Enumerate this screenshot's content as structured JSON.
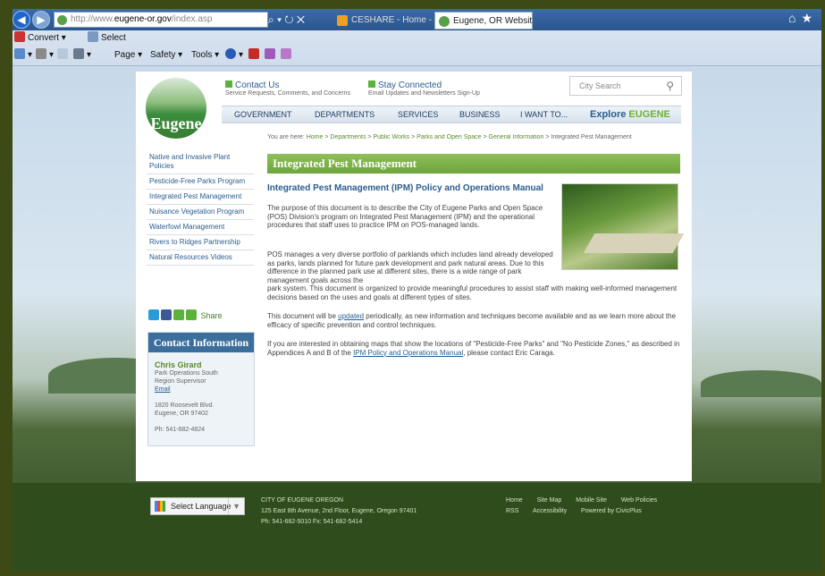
{
  "browser": {
    "url_prefix": "http://www.",
    "url_domain": "eugene-or.gov",
    "url_suffix": "/index.asp",
    "addr_controls": "⌕ ▾ ↻ ✕",
    "tabs": [
      {
        "label": "CESHARE - Home - Cit..."
      },
      {
        "label": "Eugene, OR Website... ×"
      }
    ],
    "toolbar1": {
      "convert": "Convert ▾",
      "select": "Select"
    },
    "toolbar2": {
      "page": "Page ▾",
      "safety": "Safety ▾",
      "tools": "Tools ▾"
    }
  },
  "site": {
    "logo": "Eugene",
    "contact_us": {
      "title": "Contact Us",
      "sub": "Service Requests, Comments, and Concerns"
    },
    "stay_connected": {
      "title": "Stay Connected",
      "sub": "Email Updates and Newsletters Sign-Up"
    },
    "search_placeholder": "City Search",
    "nav": {
      "government": "GOVERNMENT",
      "departments": "DEPARTMENTS",
      "services": "SERVICES",
      "business": "BUSINESS",
      "i_want_to": "I WANT TO...",
      "explore": "Explore",
      "explore_city": "EUGENE"
    },
    "breadcrumb": {
      "prefix": "You are here:",
      "home": "Home",
      "departments": "Departments",
      "public_works": "Public Works",
      "parks": "Parks and Open Space",
      "general": "General Information",
      "current": "Integrated Pest Management",
      "sep": " > "
    },
    "sidebar": [
      {
        "label": "Native and Invasive Plant Policies"
      },
      {
        "label": "Pesticide-Free Parks Program"
      },
      {
        "label": "Integrated Pest Management"
      },
      {
        "label": "Nuisance Vegetation Program"
      },
      {
        "label": "Waterfowl Management"
      },
      {
        "label": "Rivers to Ridges Partnership"
      },
      {
        "label": "Natural Resources Videos"
      }
    ],
    "share": "Share",
    "contact_box": {
      "heading": "Contact Information",
      "name": "Chris Girard",
      "role1": "Park Operations South",
      "role2": "Region Supervisor",
      "email": "Email",
      "address1": "1820 Roosevelt Blvd.",
      "address2": "Eugene, OR 97402",
      "phone": "Ph: 541-682-4824"
    },
    "page_title": "Integrated Pest Management",
    "doc_heading": "Integrated Pest Management (IPM) Policy and Operations Manual",
    "para1": "The purpose of this document is to describe the City of Eugene Parks and Open Space (POS) Division's program on Integrated Pest Management (IPM) and the operational procedures that staff uses to practice IPM on POS-managed lands.",
    "para2a": "POS manages a very diverse portfolio of parklands which includes land already developed as parks, lands planned for future park development and park natural areas. Due to this difference in the planned park use at different sites, there is a wide range of park management goals across the",
    "para2b": "park system. This document is organized to provide meaningful procedures to assist staff with making well-informed management decisions based on the uses and goals at different types of sites.",
    "para3_pre": "This document will be ",
    "para3_link": "updated",
    "para3_post": " periodically, as new information and techniques become available and as we learn more about the efficacy of specific prevention and control techniques.",
    "para4_pre": "If you are interested in obtaining maps that show the locations of \"Pesticide-Free Parks\" and \"No Pesticide Zones,\" as described in Appendices A and B of the ",
    "para4_link": "IPM Policy and Operations Manual",
    "para4_post": ", please contact Eric Caraga."
  },
  "footer": {
    "select_language": "Select Language",
    "city": "CITY OF EUGENE OREGON",
    "address": "125 East 8th Avenue, 2nd Floor, Eugene, Oregon 97401",
    "phones": "Ph: 541-682-5010   Fx: 541-682-5414",
    "links_row1": [
      "Home",
      "Site Map",
      "Mobile Site",
      "Web Policies"
    ],
    "links_row2": [
      "RSS",
      "Accessibility",
      "Powered by CivicPlus"
    ]
  }
}
